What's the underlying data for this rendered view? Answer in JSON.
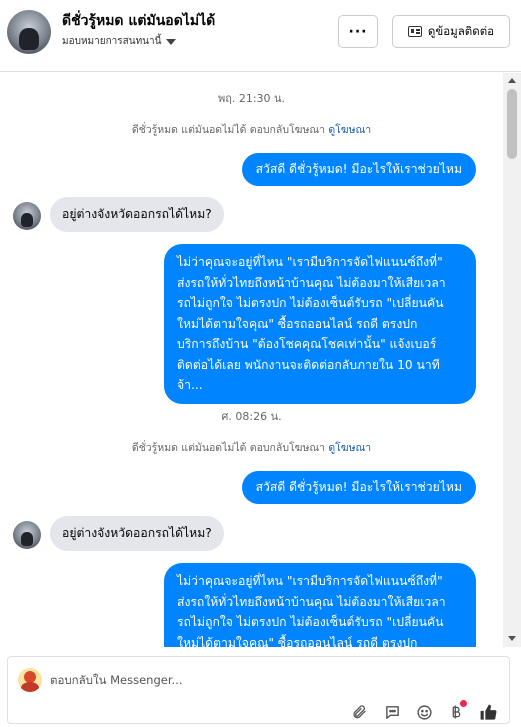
{
  "header": {
    "page_name": "ดีชั่วรู้หมด แต่มันอดไม่ได้",
    "assignee_label": "มอบหมายการสนทนานี้",
    "more_label": "···",
    "contact_info_label": "ดูข้อมูลติดต่อ"
  },
  "thread": {
    "timestamp_1": "พฤ. 21:30 น.",
    "timestamp_2": "ศ. 08:26 น.",
    "system_note_text": "ดีชั่วรู้หมด แต่มันอดไม่ได้ ตอบกลับโฆษณา",
    "system_note_link": "ดูโฆษณา",
    "greeting_out": "สวัสดี ดีชั่วรู้หมด! มีอะไรให้เราช่วยไหม",
    "question_in": "อยู่ต่างจังหวัดออกรถได้ไหม?",
    "long_reply_lines": [
      "ไม่ว่าคุณจะอยู่ที่ไหน \"เรามีบริการจัดไฟแนนซ์ถึงที่\"",
      "ส่งรถให้ทั่วไทยถึงหน้าบ้านคุณ ไม่ต้องมาให้เสียเวลา",
      "รถไม่ถูกใจ ไม่ตรงปก ไม่ต้องเซ็นต์รับรถ \"เปลี่ยนคัน",
      "ใหม่ได้ตามใจคุณ\" ซื้อรถออนไลน์ รถดี ตรงปก",
      "บริการถึงบ้าน \"ต้องโชคคุณโชคเท่านั้น\" แจ้งเบอร์",
      "ติดต่อได้เลย พนักงานจะติดต่อกลับภายใน 10 นาที",
      "จ้า..."
    ]
  },
  "composer": {
    "placeholder": "ตอบกลับใน Messenger...",
    "tools": [
      "paperclip-icon",
      "chat-bubble-icon",
      "emoji-icon",
      "baht-icon",
      "thumbs-up-icon"
    ]
  },
  "colors": {
    "outgoing_bubble": "#0084ff",
    "incoming_bubble": "#e4e6eb",
    "link": "#1a5fb4"
  }
}
